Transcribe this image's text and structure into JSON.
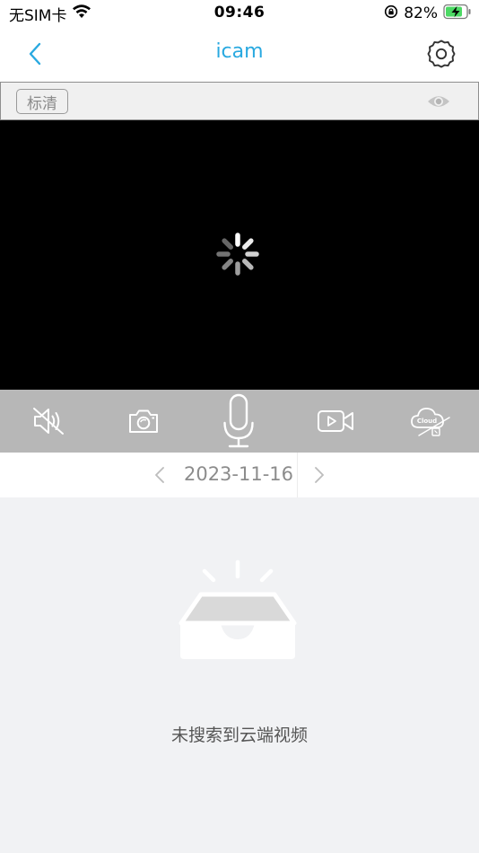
{
  "status_bar": {
    "carrier": "无SIM卡",
    "time": "09:46",
    "battery_percent": "82%",
    "battery_level": 0.82,
    "battery_color": "#4cd964"
  },
  "nav": {
    "title": "icam",
    "title_color": "#29a9e0",
    "back_icon": "chevron-left-icon",
    "settings_icon": "gear-icon"
  },
  "player": {
    "quality_label": "标清",
    "visibility_icon": "eye-icon",
    "loading_icon": "spinner-icon"
  },
  "controls": [
    {
      "name": "mute-button",
      "icon": "speaker-muted-icon"
    },
    {
      "name": "snapshot-button",
      "icon": "camera-icon"
    },
    {
      "name": "talk-button",
      "icon": "microphone-icon"
    },
    {
      "name": "record-button",
      "icon": "video-record-icon"
    },
    {
      "name": "cloud-button",
      "icon": "cloud-disabled-icon",
      "label": "Cloud"
    }
  ],
  "date_selector": {
    "date": "2023-11-16",
    "prev_icon": "chevron-left-icon",
    "next_icon": "chevron-right-icon"
  },
  "cloud_list": {
    "empty_message": "未搜索到云端视频",
    "empty_icon": "empty-tray-icon"
  }
}
